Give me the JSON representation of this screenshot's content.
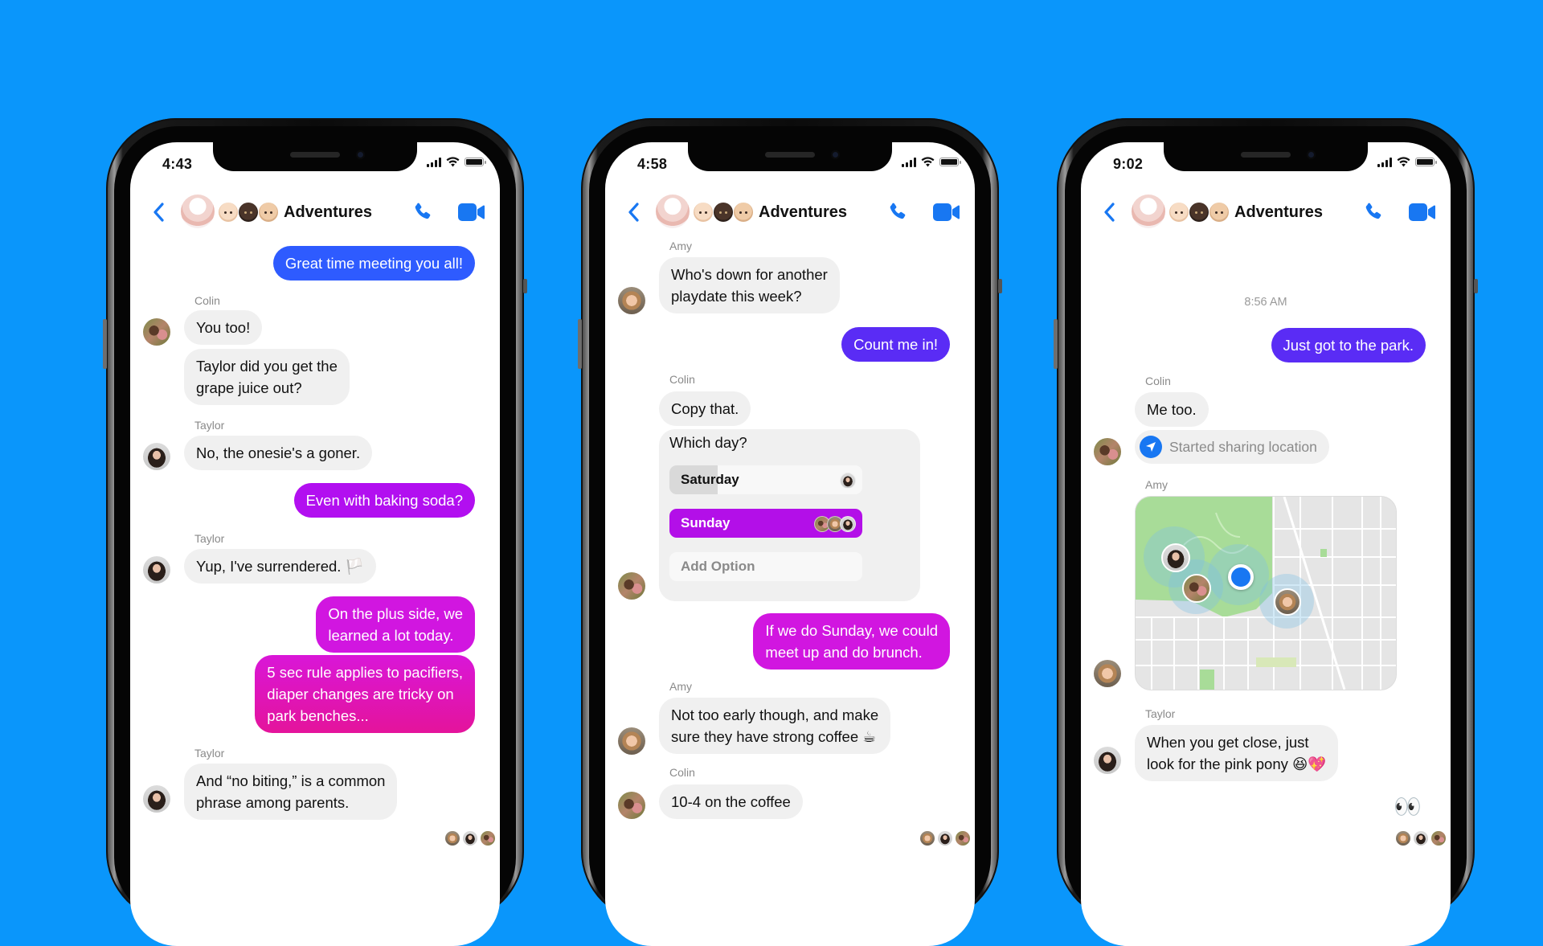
{
  "background_color": "#0a96fb",
  "colors": {
    "header_icon_blue": "#1877f2",
    "bubble_incoming": "#f0f0f0",
    "sender_label": "#8a8a8a"
  },
  "phones": [
    {
      "status": {
        "time": "4:43"
      },
      "header": {
        "title": "Adventures",
        "emoji": [
          "baby-light",
          "baby-dark",
          "baby-medium"
        ],
        "icons": [
          "back-chevron-icon",
          "group-avatar",
          "phone-call-icon",
          "video-call-icon"
        ]
      },
      "messages": [
        {
          "from": "me",
          "text": "Great time meeting you all!"
        },
        {
          "sender": "Colin",
          "text": "You too!"
        },
        {
          "sender": "Colin",
          "text_lines": [
            "Taylor did you get the",
            "grape juice out?"
          ]
        },
        {
          "sender": "Taylor",
          "text": "No, the onesie's a goner."
        },
        {
          "from": "me",
          "text": "Even with baking soda?"
        },
        {
          "sender": "Taylor",
          "text": "Yup, I've surrendered. 🏳️"
        },
        {
          "from": "me",
          "text_lines": [
            "On the plus side, we",
            "learned a lot today."
          ]
        },
        {
          "from": "me",
          "text_lines": [
            "5 sec rule applies to pacifiers,",
            "diaper changes are tricky on",
            "park benches..."
          ]
        },
        {
          "sender": "Taylor",
          "text_lines": [
            "And “no biting,” is a common",
            "phrase among parents."
          ]
        }
      ],
      "read_receipts": [
        "Amy",
        "Taylor",
        "Colin"
      ]
    },
    {
      "status": {
        "time": "4:58"
      },
      "header": {
        "title": "Adventures"
      },
      "messages": [
        {
          "sender": "Amy",
          "text_lines": [
            "Who's down for another",
            "playdate this week?"
          ]
        },
        {
          "from": "me",
          "text": "Count me in!"
        },
        {
          "sender": "Colin",
          "text": "Copy that."
        },
        {
          "sender": "Colin",
          "type": "poll",
          "poll": {
            "question": "Which day?",
            "options": [
              {
                "label": "Saturday",
                "votes": 1,
                "fill_fraction": 0.25,
                "voters": [
                  "Taylor"
                ]
              },
              {
                "label": "Sunday",
                "votes": 3,
                "fill_fraction": 1.0,
                "voters": [
                  "Colin",
                  "Amy",
                  "Taylor"
                ],
                "selected": true
              }
            ],
            "add_option_label": "Add Option"
          }
        },
        {
          "from": "me",
          "text_lines": [
            "If we do Sunday, we could",
            "meet up and do brunch."
          ]
        },
        {
          "sender": "Amy",
          "text_lines": [
            "Not too early though, and make",
            "sure they have strong coffee ☕"
          ]
        },
        {
          "sender": "Colin",
          "text": "10-4 on the coffee"
        }
      ],
      "read_receipts": [
        "Amy",
        "Taylor",
        "Colin"
      ]
    },
    {
      "status": {
        "time": "9:02"
      },
      "header": {
        "title": "Adventures"
      },
      "timestamp": "8:56 AM",
      "messages": [
        {
          "from": "me",
          "text": "Just got to the park."
        },
        {
          "sender": "Colin",
          "text": "Me too."
        },
        {
          "sender": "Colin",
          "type": "location",
          "text": "Started sharing location"
        },
        {
          "sender": "Amy",
          "type": "map",
          "map": {
            "people_on_map": [
              "Taylor",
              "Colin",
              "me",
              "Amy"
            ]
          }
        },
        {
          "sender": "Taylor",
          "text_lines": [
            "When you get close, just",
            "look for the pink pony 😆💖"
          ]
        },
        {
          "from": "me",
          "type": "emoji",
          "text": "👀"
        }
      ],
      "read_receipts": [
        "Amy",
        "Taylor",
        "Colin"
      ]
    }
  ]
}
